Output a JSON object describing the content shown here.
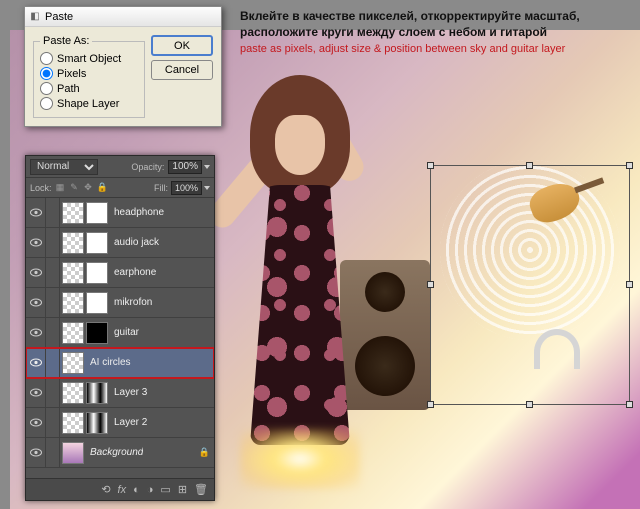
{
  "instruction": {
    "ru": "Вклейте в качестве пикселей, откорректируйте масштаб, расположите круги между слоем с небом и гитарой",
    "en": "paste as pixels, adjust size & position between sky and guitar layer"
  },
  "dialog": {
    "title": "Paste",
    "legend": "Paste As:",
    "options": {
      "smart_object": "Smart Object",
      "pixels": "Pixels",
      "path": "Path",
      "shape_layer": "Shape Layer"
    },
    "selected": "pixels",
    "ok": "OK",
    "cancel": "Cancel"
  },
  "panel": {
    "blend_mode": "Normal",
    "opacity_label": "Opacity:",
    "opacity_value": "100%",
    "lock_label": "Lock:",
    "fill_label": "Fill:",
    "fill_value": "100%",
    "layers": [
      {
        "name": "headphone"
      },
      {
        "name": "audio jack"
      },
      {
        "name": "earphone"
      },
      {
        "name": "mikrofon"
      },
      {
        "name": "guitar"
      },
      {
        "name": "AI circles"
      },
      {
        "name": "Layer 3"
      },
      {
        "name": "Layer 2"
      },
      {
        "name": "Background"
      }
    ]
  }
}
